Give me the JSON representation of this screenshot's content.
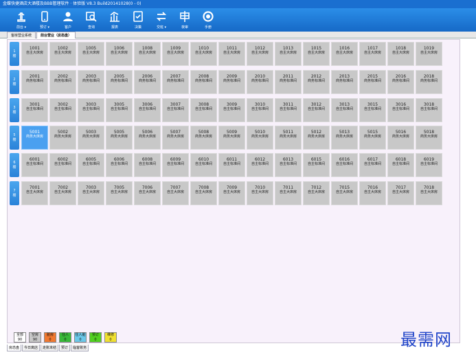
{
  "window": {
    "title": "金蝶快捷酒店大酒楼及BBB管理软件 · 体验版 V8.3 Build20141028(0 - 0)"
  },
  "toolbar": [
    {
      "label": "前台 ▾",
      "icon": "reception-icon"
    },
    {
      "label": "预订 ▾",
      "icon": "phone-icon"
    },
    {
      "label": "客户",
      "icon": "customer-icon"
    },
    {
      "label": "查询",
      "icon": "search-icon"
    },
    {
      "label": "报表",
      "icon": "report-icon"
    },
    {
      "label": "决策",
      "icon": "decision-icon"
    },
    {
      "label": "交班 ▾",
      "icon": "shift-icon"
    },
    {
      "label": "夜审",
      "icon": "audit-icon"
    },
    {
      "label": "手册",
      "icon": "manual-icon"
    }
  ],
  "tabs": [
    {
      "label": "客房营业系统",
      "active": false
    },
    {
      "label": "前台营业（房态盘）",
      "active": true
    }
  ],
  "floors": [
    {
      "label": [
        "1",
        "楼"
      ],
      "rooms": [
        {
          "num": "1001",
          "type": "自主大床房"
        },
        {
          "num": "1002",
          "type": "自主大床房"
        },
        {
          "num": "1005",
          "type": "自主大床房"
        },
        {
          "num": "1006",
          "type": "自主大床房"
        },
        {
          "num": "1008",
          "type": "自主大床房"
        },
        {
          "num": "1009",
          "type": "自主大床房"
        },
        {
          "num": "1010",
          "type": "自主大床房"
        },
        {
          "num": "1011",
          "type": "自主大床房"
        },
        {
          "num": "1012",
          "type": "自主大床房"
        },
        {
          "num": "1013",
          "type": "自主大床房"
        },
        {
          "num": "1015",
          "type": "自主大床房"
        },
        {
          "num": "1016",
          "type": "自主大床房"
        },
        {
          "num": "1017",
          "type": "自主大床房"
        },
        {
          "num": "1018",
          "type": "自主大床房"
        },
        {
          "num": "1019",
          "type": "自主大床房"
        }
      ]
    },
    {
      "label": [
        "2",
        "楼"
      ],
      "rooms": [
        {
          "num": "2001",
          "type": "商务标准间"
        },
        {
          "num": "2002",
          "type": "商务标准间"
        },
        {
          "num": "2003",
          "type": "商务标准间"
        },
        {
          "num": "2005",
          "type": "商务标准间"
        },
        {
          "num": "2006",
          "type": "商务标准间"
        },
        {
          "num": "2007",
          "type": "商务标准间"
        },
        {
          "num": "2008",
          "type": "商务标准间"
        },
        {
          "num": "2009",
          "type": "商务标准间"
        },
        {
          "num": "2010",
          "type": "商务标准间"
        },
        {
          "num": "2011",
          "type": "商务标准间"
        },
        {
          "num": "2012",
          "type": "商务标准间"
        },
        {
          "num": "2013",
          "type": "商务标准间"
        },
        {
          "num": "2015",
          "type": "商务标准间"
        },
        {
          "num": "2016",
          "type": "商务标准间"
        },
        {
          "num": "2018",
          "type": "商务标准间"
        }
      ]
    },
    {
      "label": [
        "3",
        "楼"
      ],
      "rooms": [
        {
          "num": "3001",
          "type": "自主标准间"
        },
        {
          "num": "3002",
          "type": "自主标准间"
        },
        {
          "num": "3003",
          "type": "自主标准间"
        },
        {
          "num": "3005",
          "type": "自主标准间"
        },
        {
          "num": "3006",
          "type": "自主标准间"
        },
        {
          "num": "3007",
          "type": "自主标准间"
        },
        {
          "num": "3008",
          "type": "自主标准间"
        },
        {
          "num": "3009",
          "type": "自主标准间"
        },
        {
          "num": "3010",
          "type": "自主标准间"
        },
        {
          "num": "3011",
          "type": "自主标准间"
        },
        {
          "num": "3012",
          "type": "自主标准间"
        },
        {
          "num": "3013",
          "type": "自主标准间"
        },
        {
          "num": "3015",
          "type": "自主标准间"
        },
        {
          "num": "3016",
          "type": "自主标准间"
        },
        {
          "num": "3018",
          "type": "自主标准间"
        }
      ]
    },
    {
      "label": [
        "5",
        "楼"
      ],
      "rooms": [
        {
          "num": "5001",
          "type": "商务大床房",
          "selected": true
        },
        {
          "num": "5002",
          "type": "商务大床房"
        },
        {
          "num": "5003",
          "type": "商务大床房"
        },
        {
          "num": "5005",
          "type": "商务大床房"
        },
        {
          "num": "5006",
          "type": "商务大床房"
        },
        {
          "num": "5007",
          "type": "商务大床房"
        },
        {
          "num": "5008",
          "type": "商务大床房"
        },
        {
          "num": "5009",
          "type": "商务大床房"
        },
        {
          "num": "5010",
          "type": "商务大床房"
        },
        {
          "num": "5011",
          "type": "商务大床房"
        },
        {
          "num": "5012",
          "type": "商务大床房"
        },
        {
          "num": "5013",
          "type": "商务大床房"
        },
        {
          "num": "5015",
          "type": "商务大床房"
        },
        {
          "num": "5016",
          "type": "商务大床房"
        },
        {
          "num": "5018",
          "type": "商务大床房"
        }
      ]
    },
    {
      "label": [
        "6",
        "楼"
      ],
      "rooms": [
        {
          "num": "6001",
          "type": "自主标准间"
        },
        {
          "num": "6002",
          "type": "自主标准间"
        },
        {
          "num": "6005",
          "type": "自主标准间"
        },
        {
          "num": "6006",
          "type": "自主标准间"
        },
        {
          "num": "6008",
          "type": "自主标准间"
        },
        {
          "num": "6009",
          "type": "自主标准间"
        },
        {
          "num": "6010",
          "type": "自主标准间"
        },
        {
          "num": "6011",
          "type": "自主标准间"
        },
        {
          "num": "6012",
          "type": "自主标准间"
        },
        {
          "num": "6013",
          "type": "自主标准间"
        },
        {
          "num": "6015",
          "type": "自主标准间"
        },
        {
          "num": "6016",
          "type": "自主标准间"
        },
        {
          "num": "6017",
          "type": "自主标准间"
        },
        {
          "num": "6018",
          "type": "自主标准间"
        },
        {
          "num": "6019",
          "type": "自主标准间"
        }
      ]
    },
    {
      "label": [
        "7",
        "楼"
      ],
      "rooms": [
        {
          "num": "7001",
          "type": "自主大床房"
        },
        {
          "num": "7002",
          "type": "自主大床房"
        },
        {
          "num": "7003",
          "type": "自主大床房"
        },
        {
          "num": "7005",
          "type": "自主大床房"
        },
        {
          "num": "7006",
          "type": "自主大床房"
        },
        {
          "num": "7007",
          "type": "自主大床房"
        },
        {
          "num": "7008",
          "type": "自主大床房"
        },
        {
          "num": "7009",
          "type": "自主大床房"
        },
        {
          "num": "7010",
          "type": "自主大床房"
        },
        {
          "num": "7011",
          "type": "自主大床房"
        },
        {
          "num": "7012",
          "type": "自主大床房"
        },
        {
          "num": "7015",
          "type": "自主大床房"
        },
        {
          "num": "7016",
          "type": "自主大床房"
        },
        {
          "num": "7017",
          "type": "自主大床房"
        },
        {
          "num": "7018",
          "type": "自主大床房"
        }
      ]
    }
  ],
  "legend": [
    {
      "label": "全部",
      "count": "90",
      "color": "#ffffff"
    },
    {
      "label": "空房",
      "count": "90",
      "color": "#c8c8c8"
    },
    {
      "label": "脏房",
      "count": "0",
      "color": "#f07830"
    },
    {
      "label": "住人",
      "count": "0",
      "color": "#38b838"
    },
    {
      "label": "住人脏",
      "count": "0",
      "color": "#6bc8e8"
    },
    {
      "label": "预订",
      "count": "0",
      "color": "#50d020"
    },
    {
      "label": "维修",
      "count": "0",
      "color": "#f0e030"
    }
  ],
  "bottom_tabs": [
    {
      "label": "房态盘",
      "active": true
    },
    {
      "label": "今日离店",
      "active": false
    },
    {
      "label": "走账未结",
      "active": false
    },
    {
      "label": "预订",
      "active": false
    },
    {
      "label": "临客账务",
      "active": false
    }
  ],
  "watermark": "最需网"
}
